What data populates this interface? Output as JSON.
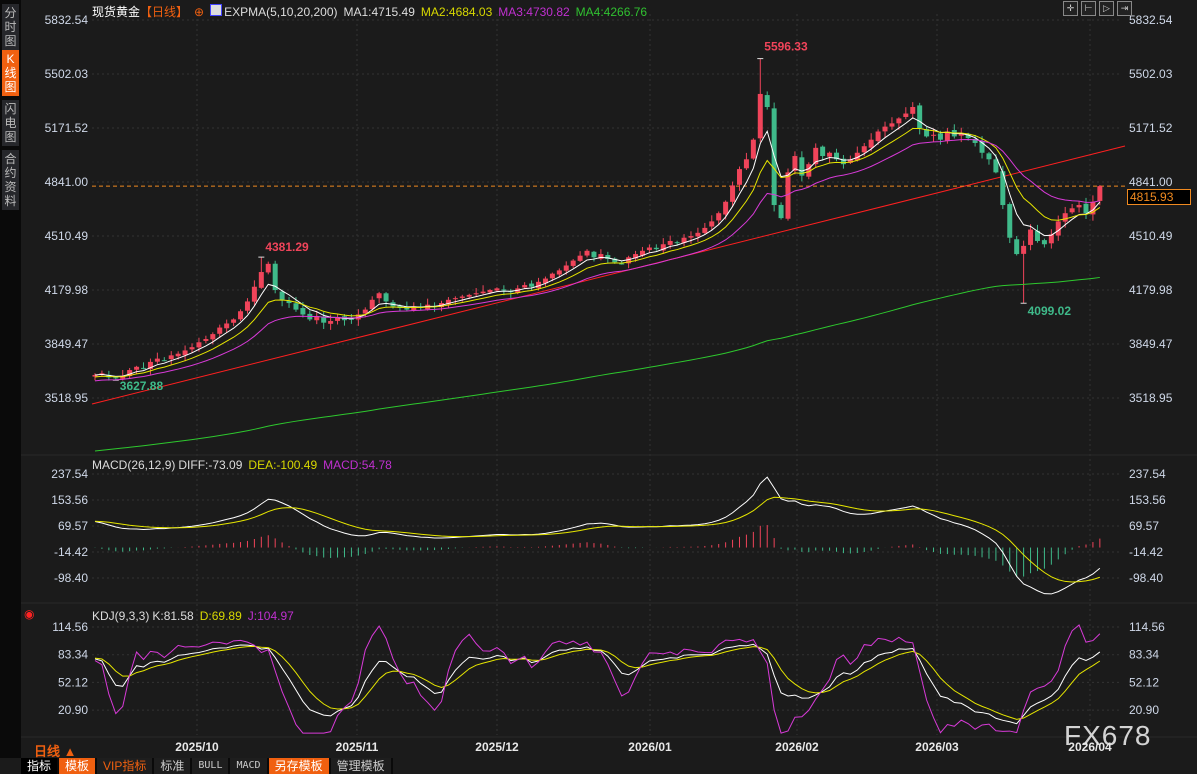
{
  "sidebar": {
    "tabs": [
      {
        "label": "分时图",
        "active": false
      },
      {
        "label": "K线图",
        "active": true
      },
      {
        "label": "闪电图",
        "active": false
      },
      {
        "label": "合约资料",
        "active": false
      }
    ]
  },
  "header": {
    "symbol": "现货黄金",
    "period": "【日线】",
    "indicator": "EXPMA(5,10,20,200)",
    "ma1": "MA1:4715.49",
    "ma2": "MA2:4684.03",
    "ma3": "MA3:4730.82",
    "ma4": "MA4:4266.76"
  },
  "toolbar_icons": [
    "crosshair-icon",
    "zoom-start-icon",
    "zoom-end-icon",
    "shift-right-icon"
  ],
  "colors": {
    "up": "#f0445a",
    "down": "#3fba8a",
    "ma1": "#ffffff",
    "ma2": "#e6e600",
    "ma3": "#d83ad8",
    "ma4": "#2ec82e",
    "trendline": "#ff2020",
    "current": "#f08a20"
  },
  "macd_header": {
    "name": "MACD(26,12,9)",
    "diff": "DIFF:-73.09",
    "dea": "DEA:-100.49",
    "macd": "MACD:54.78"
  },
  "kdj_header": {
    "name": "KDJ(9,3,3)",
    "k": "K:81.58",
    "d": "D:69.89",
    "j": "J:104.97"
  },
  "current_price": "4815.93",
  "bottom": {
    "period_label": "日线 ▲",
    "buttons": [
      "指标",
      "模板",
      "VIP指标",
      "标准",
      "BULL",
      "MACD",
      "另存模板",
      "管理模板"
    ]
  },
  "watermark": "FX678",
  "chart_data": [
    {
      "type": "candlestick",
      "title": "现货黄金 日线",
      "price_ticks": [
        "5832.54",
        "5502.03",
        "5171.52",
        "4841.00",
        "4510.49",
        "4179.98",
        "3849.47",
        "3518.95"
      ],
      "ylim": [
        3518.95,
        5832.54
      ],
      "x_ticks": [
        "2025/10",
        "2025/11",
        "2025/12",
        "2026/01",
        "2026/02",
        "2026/03",
        "2026/04"
      ],
      "annotations": [
        {
          "label": "5596.33",
          "type": "high"
        },
        {
          "label": "4381.29",
          "type": "high"
        },
        {
          "label": "3627.88",
          "type": "low"
        },
        {
          "label": "4099.02",
          "type": "low"
        }
      ],
      "close": [
        3660,
        3670,
        3645,
        3640,
        3655,
        3690,
        3710,
        3700,
        3740,
        3760,
        3750,
        3780,
        3790,
        3810,
        3830,
        3860,
        3880,
        3910,
        3950,
        3975,
        4000,
        4050,
        4110,
        4200,
        4290,
        4340,
        4180,
        4120,
        4100,
        4060,
        4030,
        4000,
        4020,
        3980,
        3990,
        4010,
        3995,
        4000,
        4030,
        4060,
        4120,
        4160,
        4110,
        4080,
        4070,
        4060,
        4080,
        4070,
        4090,
        4080,
        4100,
        4120,
        4130,
        4140,
        4150,
        4160,
        4170,
        4180,
        4190,
        4180,
        4170,
        4190,
        4210,
        4200,
        4230,
        4250,
        4280,
        4300,
        4330,
        4360,
        4390,
        4420,
        4380,
        4400,
        4370,
        4350,
        4340,
        4380,
        4400,
        4420,
        4440,
        4430,
        4460,
        4480,
        4470,
        4500,
        4510,
        4530,
        4560,
        4600,
        4650,
        4720,
        4820,
        4920,
        4980,
        5100,
        5380,
        5300,
        4700,
        4620,
        4900,
        5000,
        4880,
        4950,
        5050,
        5000,
        5020,
        4980,
        4950,
        4980,
        5020,
        5060,
        5100,
        5150,
        5180,
        5200,
        5230,
        5260,
        5300,
        5170,
        5120,
        5130,
        5100,
        5150,
        5120,
        5140,
        5110,
        5080,
        5020,
        4980,
        4900,
        4700,
        4500,
        4400,
        4450,
        4550,
        4480,
        4460,
        4520,
        4600,
        4650,
        4680,
        4700,
        4650,
        4720,
        4815.93
      ],
      "highlights": {
        "high": [
          24,
          5596.33,
          96,
          4381.29
        ],
        "low": [
          3,
          3627.88,
          134,
          4099.02
        ]
      },
      "series": [
        "MA1",
        "MA2",
        "MA3",
        "MA4"
      ]
    },
    {
      "type": "bar+line",
      "name": "MACD(26,12,9)",
      "ticks": [
        "237.54",
        "153.56",
        "69.57",
        "-14.42",
        "-98.40"
      ],
      "ylim": [
        -98.4,
        237.54
      ]
    },
    {
      "type": "line",
      "name": "KDJ(9,3,3)",
      "ticks": [
        "114.56",
        "83.34",
        "52.12",
        "20.90"
      ],
      "ylim": [
        20.9,
        114.56
      ]
    }
  ]
}
